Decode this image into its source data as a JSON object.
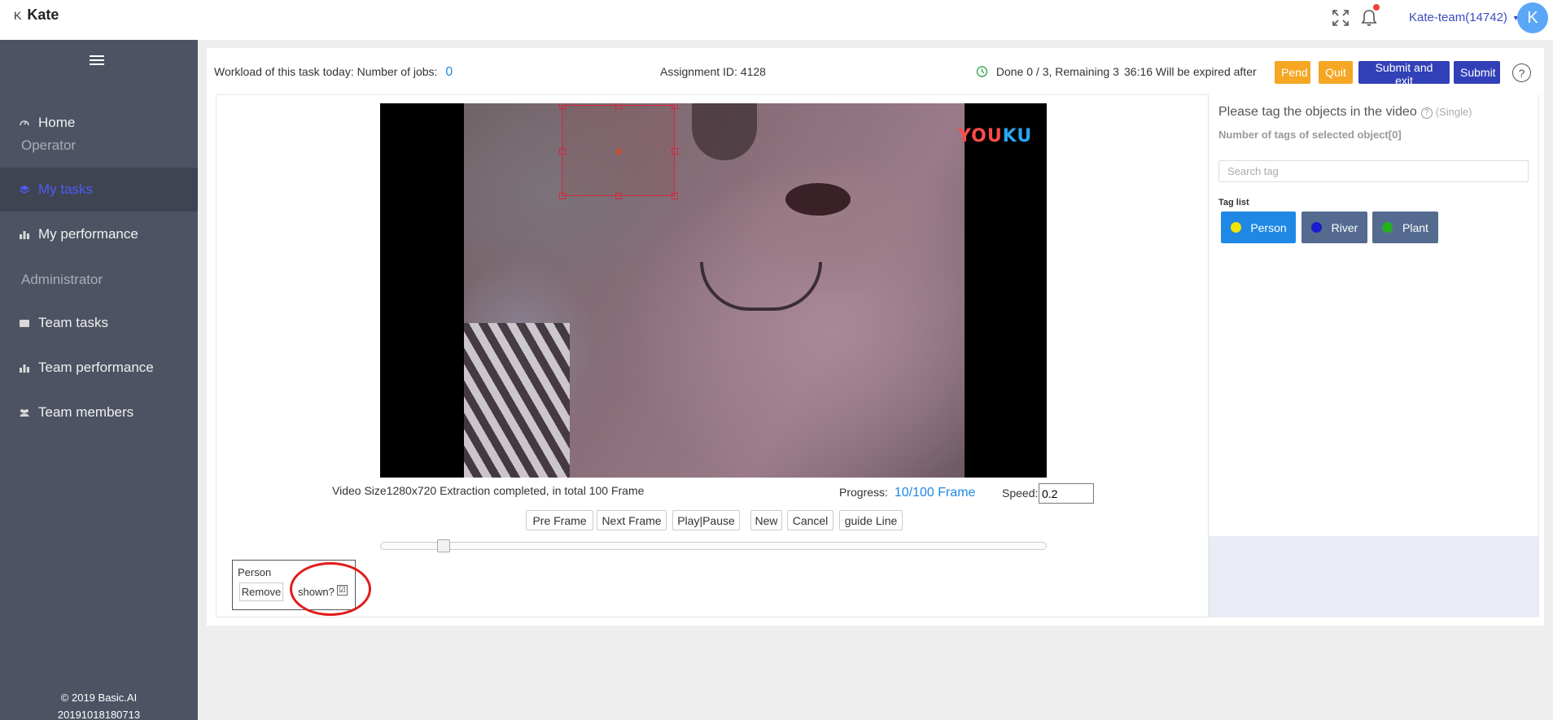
{
  "header": {
    "logo_mark": "K",
    "app_name": "Kate",
    "team_label": "Kate-team(14742)",
    "avatar_initial": "K"
  },
  "sidebar": {
    "items": [
      {
        "label": "Home",
        "icon": "dashboard-icon"
      },
      {
        "label": "My tasks",
        "icon": "layers-icon",
        "active": true
      },
      {
        "label": "My performance",
        "icon": "bar-chart-icon"
      },
      {
        "label": "Team tasks",
        "icon": "folder-icon"
      },
      {
        "label": "Team performance",
        "icon": "bar-chart-icon"
      },
      {
        "label": "Team members",
        "icon": "users-icon"
      }
    ],
    "groups": [
      "Operator",
      "Administrator"
    ],
    "footer_copyright": "© 2019 Basic.AI",
    "footer_build": "20191018180713"
  },
  "task": {
    "workload_label": "Workload of this task today: Number of jobs:",
    "jobs_count": "0",
    "assignment_id": "Assignment ID: 4128",
    "done_status": "Done 0 / 3, Remaining 3",
    "expiry": "36:16 Will be expired after",
    "buttons": {
      "pend": "Pend",
      "quit": "Quit",
      "submit_exit": "Submit and exit",
      "submit": "Submit"
    },
    "help": "?"
  },
  "video": {
    "watermark_a": "YOU",
    "watermark_b": "KU",
    "meta": "Video Size1280x720 Extraction completed, in total 100 Frame",
    "progress_label": "Progress:",
    "progress_value": "10/100 Frame",
    "progress_fraction": 0.1,
    "speed_label": "Speed:",
    "speed_value": "0.2",
    "controls": {
      "pre_frame": "Pre Frame",
      "next_frame": "Next Frame",
      "play_pause": "Play|Pause",
      "new": "New",
      "cancel": "Cancel",
      "guide_line": "guide Line"
    }
  },
  "object": {
    "name": "Person",
    "remove_label": "Remove",
    "shown_label": "shown?",
    "shown_checked": "☑"
  },
  "tag_panel": {
    "title": "Please tag the objects in the video",
    "mode": "(Single)",
    "count_label": "Number of tags of selected object[0]",
    "search_placeholder": "Search tag",
    "list_label": "Tag list",
    "tags": [
      {
        "label": "Person",
        "dot_color": "#f2e600",
        "bg_color": "#1f88e5"
      },
      {
        "label": "River",
        "dot_color": "#1a1ad0",
        "bg_color": "#546b8f"
      },
      {
        "label": "Plant",
        "dot_color": "#22b21e",
        "bg_color": "#546b8f"
      }
    ]
  }
}
